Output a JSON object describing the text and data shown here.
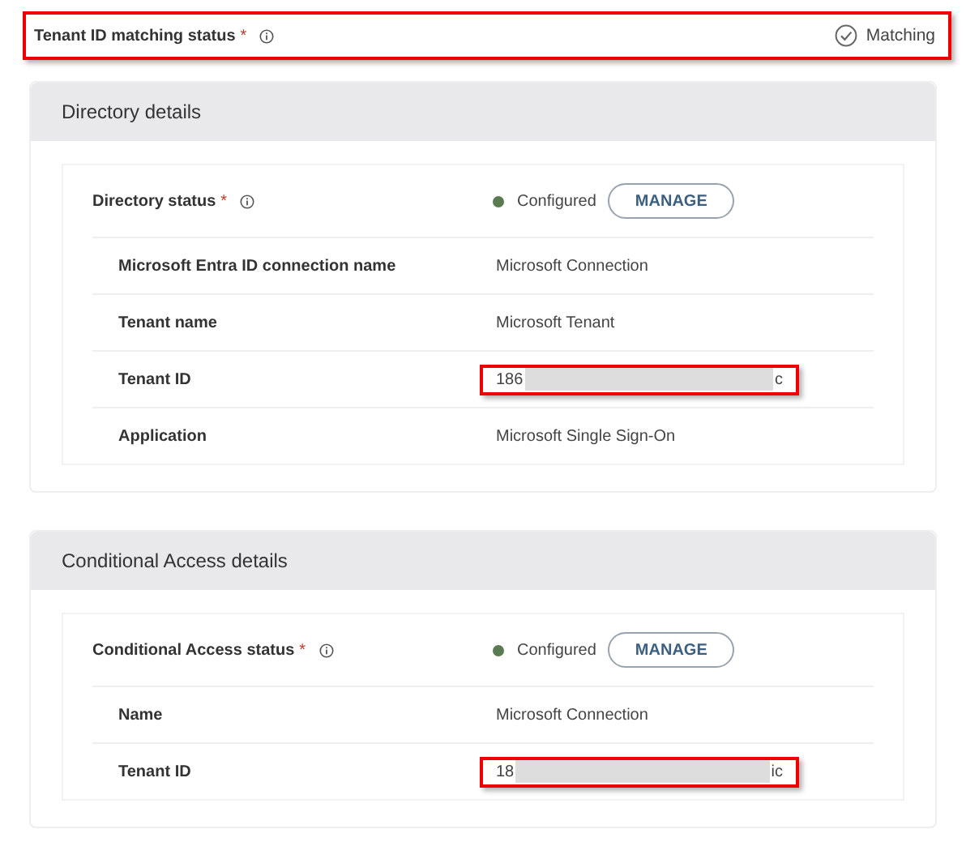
{
  "matching_status": {
    "label": "Tenant ID matching status",
    "required_mark": "*",
    "value": "Matching",
    "highlighted": true
  },
  "sections": [
    {
      "title": "Directory details",
      "status": {
        "label": "Directory status",
        "required_mark": "*",
        "value": "Configured",
        "color": "#5a7a52",
        "button": "MANAGE"
      },
      "rows": [
        {
          "label": "Microsoft Entra ID connection name",
          "value": "Microsoft Connection",
          "kind": "text",
          "highlighted": false
        },
        {
          "label": "Tenant name",
          "value": "Microsoft Tenant",
          "kind": "text",
          "highlighted": false
        },
        {
          "label": "Tenant ID",
          "value_start": "186",
          "value_end": "c",
          "kind": "redacted",
          "highlighted": true
        },
        {
          "label": "Application",
          "value": "Microsoft Single Sign-On",
          "kind": "text",
          "highlighted": false
        }
      ]
    },
    {
      "title": "Conditional Access details",
      "status": {
        "label": "Conditional Access status",
        "required_mark": "*",
        "value": "Configured",
        "color": "#5a7a52",
        "button": "MANAGE"
      },
      "rows": [
        {
          "label": "Name",
          "value": "Microsoft Connection",
          "kind": "text",
          "highlighted": false
        },
        {
          "label": "Tenant ID",
          "value_start": "18",
          "value_end": "ic",
          "kind": "redacted",
          "highlighted": true
        }
      ]
    }
  ]
}
